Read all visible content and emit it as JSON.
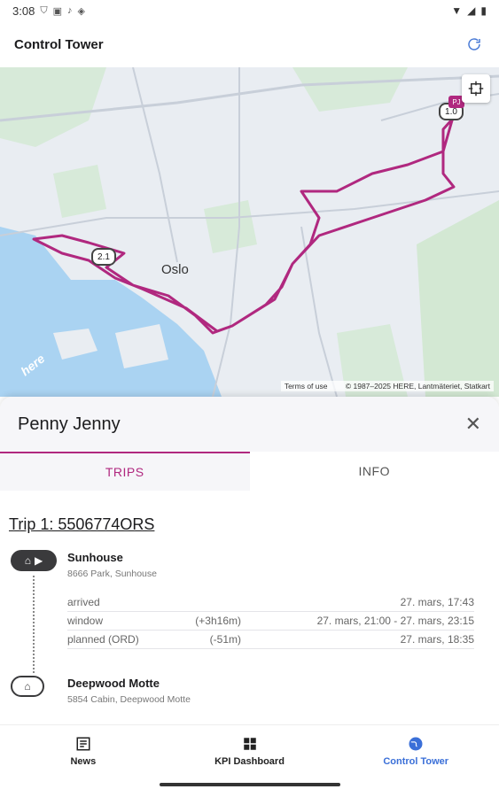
{
  "status": {
    "time": "3:08"
  },
  "appbar": {
    "title": "Control Tower",
    "refresh_icon": "refresh-icon"
  },
  "map": {
    "city_label": "Oslo",
    "markers": [
      "2.1",
      "1.0",
      "PJ"
    ],
    "terms": "Terms of use",
    "copyright": "© 1987–2025 HERE, Lantmäteriet, Statkart",
    "brand": "here",
    "route_color": "#b0287f"
  },
  "sheet": {
    "driver": "Penny Jenny",
    "tabs": [
      "TRIPS",
      "INFO"
    ],
    "trip_title": "Trip 1: 5506774ORS",
    "stops": [
      {
        "name": "Sunhouse",
        "address": "8666 Park, Sunhouse"
      },
      {
        "name": "Deepwood Motte",
        "address": "5854 Cabin, Deepwood Motte"
      }
    ],
    "rows": [
      {
        "label": "arrived",
        "delta": "",
        "value": "27. mars, 17:43"
      },
      {
        "label": "window",
        "delta": "(+3h16m)",
        "value": "27. mars, 21:00 - 27. mars, 23:15"
      },
      {
        "label": "planned (ORD)",
        "delta": "(-51m)",
        "value": "27. mars, 18:35"
      }
    ]
  },
  "nav": [
    {
      "label": "News",
      "icon": "news-icon"
    },
    {
      "label": "KPI Dashboard",
      "icon": "grid-icon"
    },
    {
      "label": "Control Tower",
      "icon": "globe-icon"
    }
  ],
  "colors": {
    "accent": "#b0287f",
    "nav_active": "#3a6fd8"
  }
}
